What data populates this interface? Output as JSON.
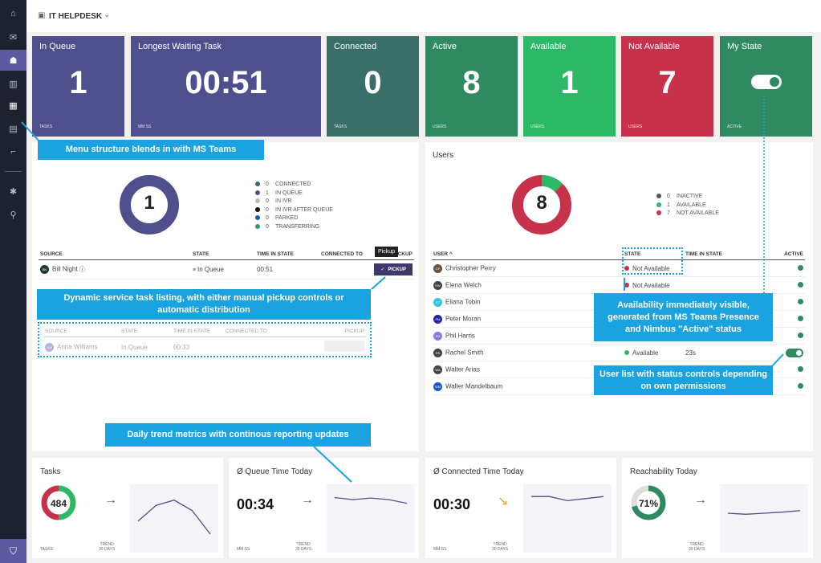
{
  "sidebar": {
    "items": [
      {
        "name": "home",
        "icon": "⌂"
      },
      {
        "name": "chat",
        "icon": "✉"
      },
      {
        "name": "teams",
        "icon": "☗",
        "active": true
      },
      {
        "name": "queues",
        "icon": "▥"
      },
      {
        "name": "dashboard",
        "icon": "▦"
      },
      {
        "name": "reports",
        "icon": "▤"
      },
      {
        "name": "flow",
        "icon": "⌐"
      },
      {
        "name": "settings",
        "icon": "✱"
      },
      {
        "name": "org",
        "icon": "⚲"
      }
    ],
    "bottom_icon": "⛉"
  },
  "header": {
    "title": "IT HELPDESK",
    "chevron": "⌄",
    "icon": "▣"
  },
  "tiles": [
    {
      "title": "In Queue",
      "value": "1",
      "unit": "TASKS",
      "color": "#4e4f8c"
    },
    {
      "title": "Longest Waiting Task",
      "value": "00:51",
      "unit": "MM:SS",
      "color": "#4e4f8c"
    },
    {
      "title": "Connected",
      "value": "0",
      "unit": "TASKS",
      "color": "#3a6e68"
    },
    {
      "title": "Active",
      "value": "8",
      "unit": "USERS",
      "color": "#2f8a62"
    },
    {
      "title": "Available",
      "value": "1",
      "unit": "USERS",
      "color": "#2cb866"
    },
    {
      "title": "Not Available",
      "value": "7",
      "unit": "USERS",
      "color": "#c8314a"
    },
    {
      "title": "My State",
      "value": "",
      "unit": "ACTIVE",
      "color": "#2f8a62"
    }
  ],
  "tasks_panel": {
    "donut_value": "1",
    "legend": [
      {
        "count": "0",
        "label": "CONNECTED",
        "color": "#3a6e68"
      },
      {
        "count": "1",
        "label": "IN QUEUE",
        "color": "#4e4f8c"
      },
      {
        "count": "0",
        "label": "IN IVR",
        "color": "#bbbbbb"
      },
      {
        "count": "0",
        "label": "IN IVR AFTER QUEUE",
        "color": "#111111"
      },
      {
        "count": "0",
        "label": "PARKED",
        "color": "#1a56c8"
      },
      {
        "count": "0",
        "label": "TRANSFERRING",
        "color": "#2f9a70"
      }
    ],
    "columns": [
      "SOURCE",
      "STATE",
      "TIME IN STATE",
      "CONNECTED TO",
      "PICKUP"
    ],
    "rows": [
      {
        "source": "Bill Night",
        "initials": "BN",
        "state": "In Queue",
        "time": "00:51",
        "connected": "",
        "pickup": "PICKUP"
      }
    ],
    "tooltip": "Pickup",
    "ghost_rows": [
      {
        "source": "Anna Williams",
        "initials": "AW",
        "state": "In Queue",
        "time": "00:33",
        "connected": ""
      }
    ]
  },
  "users_panel": {
    "title": "Users",
    "donut_value": "8",
    "legend": [
      {
        "count": "0",
        "label": "INACTIVE",
        "color": "#555555"
      },
      {
        "count": "1",
        "label": "AVAILABLE",
        "color": "#2cb866"
      },
      {
        "count": "7",
        "label": "NOT AVAILABLE",
        "color": "#c8314a"
      }
    ],
    "columns": [
      "USER ^",
      "STATE",
      "TIME IN STATE",
      "ACTIVE"
    ],
    "rows": [
      {
        "name": "Christopher Perry",
        "initials": "CP",
        "avatar": "#6b4f3f",
        "state": "Not Available",
        "state_color": "#c8314a",
        "time": "",
        "active": "dot"
      },
      {
        "name": "Elena Welch",
        "initials": "EW",
        "avatar": "#444",
        "state": "Not Available",
        "state_color": "#c8314a",
        "time": "",
        "active": "dot"
      },
      {
        "name": "Eliana Tobin",
        "initials": "ET",
        "avatar": "#2ec4e0",
        "state": "",
        "state_color": "",
        "time": "",
        "active": "dot"
      },
      {
        "name": "Peter Moran",
        "initials": "PM",
        "avatar": "#2424a0",
        "state": "",
        "state_color": "",
        "time": "",
        "active": "dot"
      },
      {
        "name": "Phil Harris",
        "initials": "PH",
        "avatar": "#8a7ae0",
        "state": "",
        "state_color": "",
        "time": "",
        "active": "dot"
      },
      {
        "name": "Rachel Smith",
        "initials": "RS",
        "avatar": "#444",
        "state": "Available",
        "state_color": "#2cb866",
        "time": "23s",
        "active": "toggle"
      },
      {
        "name": "Walter Arias",
        "initials": "WA",
        "avatar": "#444",
        "state": "",
        "state_color": "",
        "time": "",
        "active": "dot"
      },
      {
        "name": "Walter Mandelbaum",
        "initials": "WM",
        "avatar": "#1a56c8",
        "state": "",
        "state_color": "",
        "time": "",
        "active": "dot"
      }
    ]
  },
  "cards": [
    {
      "title": "Tasks",
      "value": "484",
      "unit": "TASKS",
      "trend_label": "TREND",
      "trend_period": "30 DAYS",
      "arrow": "→",
      "arrow_color": "#555a80",
      "trend": [
        0.45,
        0.75,
        0.85,
        0.65,
        0.2
      ]
    },
    {
      "title": "Ø Queue Time Today",
      "value": "00:34",
      "unit": "MM:SS",
      "trend_label": "TREND",
      "trend_period": "30 DAYS",
      "arrow": "→",
      "arrow_color": "#555a80",
      "trend": [
        0.9,
        0.86,
        0.89,
        0.86,
        0.79
      ]
    },
    {
      "title": "Ø Connected Time Today",
      "value": "00:30",
      "unit": "MM:SS",
      "trend_label": "TREND",
      "trend_period": "30 DAYS",
      "arrow": "↘",
      "arrow_color": "#f0a030",
      "trend": [
        0.92,
        0.92,
        0.84,
        0.88,
        0.92
      ]
    },
    {
      "title": "Reachability Today",
      "value": "71%",
      "unit": "",
      "trend_label": "TREND",
      "trend_period": "30 DAYS",
      "arrow": "→",
      "arrow_color": "#555a80",
      "trend": [
        0.6,
        0.58,
        0.6,
        0.62,
        0.65
      ]
    }
  ],
  "callouts": {
    "menu": "Menu structure blends in with MS Teams",
    "tasks": "Dynamic service task listing, with either manual pickup controls or automatic distribution",
    "availability": "Availability immediately visible, generated from MS Teams Presence and Nimbus \"Active\" status",
    "userlist": "User list with status controls depending on own permissions",
    "trend": "Daily trend metrics with continous reporting updates"
  }
}
